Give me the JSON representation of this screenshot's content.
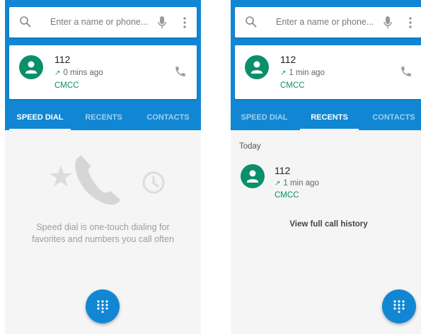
{
  "colors": {
    "primary": "#1187d3",
    "accent_green": "#0b8f6b",
    "background": "#f5f5f5"
  },
  "screens": [
    {
      "search": {
        "placeholder": "Enter a name or phone...",
        "icons": [
          "search-icon",
          "mic-icon",
          "more-vert-icon"
        ]
      },
      "recent_card": {
        "number": "112",
        "time": "0 mins ago",
        "carrier": "CMCC",
        "call_icon": "phone-icon"
      },
      "tabs": [
        {
          "label": "SPEED DIAL",
          "active": true
        },
        {
          "label": "RECENTS",
          "active": false
        },
        {
          "label": "CONTACTS",
          "active": false
        }
      ],
      "empty_state": {
        "line1": "Speed dial is one-touch dialing for",
        "line2": "favorites and numbers you call often",
        "icons": [
          "star-icon",
          "phone-icon",
          "clock-icon"
        ]
      },
      "fab_icon": "dialpad-icon"
    },
    {
      "search": {
        "placeholder": "Enter a name or phone...",
        "icons": [
          "search-icon",
          "mic-icon",
          "more-vert-icon"
        ]
      },
      "recent_card": {
        "number": "112",
        "time": "1 min ago",
        "carrier": "CMCC",
        "call_icon": "phone-icon"
      },
      "tabs": [
        {
          "label": "SPEED DIAL",
          "active": false
        },
        {
          "label": "RECENTS",
          "active": true
        },
        {
          "label": "CONTACTS",
          "active": false
        }
      ],
      "section_title": "Today",
      "recent_list": [
        {
          "number": "112",
          "time": "1 min ago",
          "carrier": "CMCC"
        }
      ],
      "history_link": "View full call history",
      "fab_icon": "dialpad-icon"
    }
  ]
}
